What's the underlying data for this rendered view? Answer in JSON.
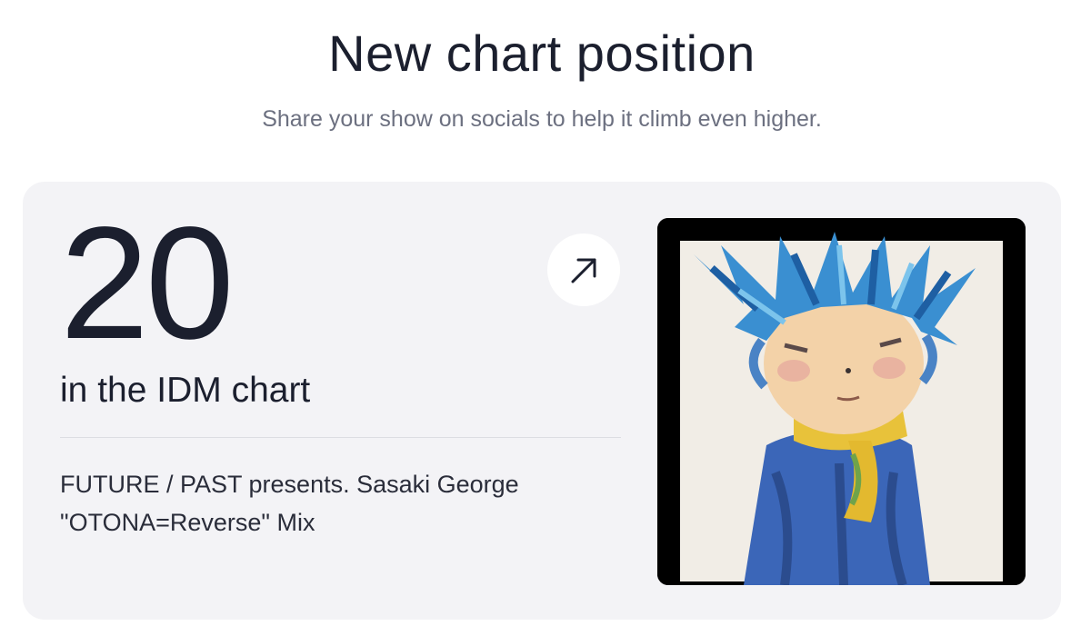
{
  "header": {
    "title": "New chart position",
    "subtitle": "Share your show on socials to help it climb even higher."
  },
  "card": {
    "rank": "20",
    "chart_label": "in the IDM chart",
    "show_title_line1": "FUTURE / PAST presents. Sasaki George",
    "show_title_line2": "\"OTONA=Reverse\" Mix",
    "share_icon": "arrow-up-right-icon",
    "artwork_description_icon": "show-artwork"
  },
  "colors": {
    "background": "#ffffff",
    "card_background": "#f3f3f6",
    "text_primary": "#1b1f2e",
    "text_secondary": "#6c7080"
  }
}
